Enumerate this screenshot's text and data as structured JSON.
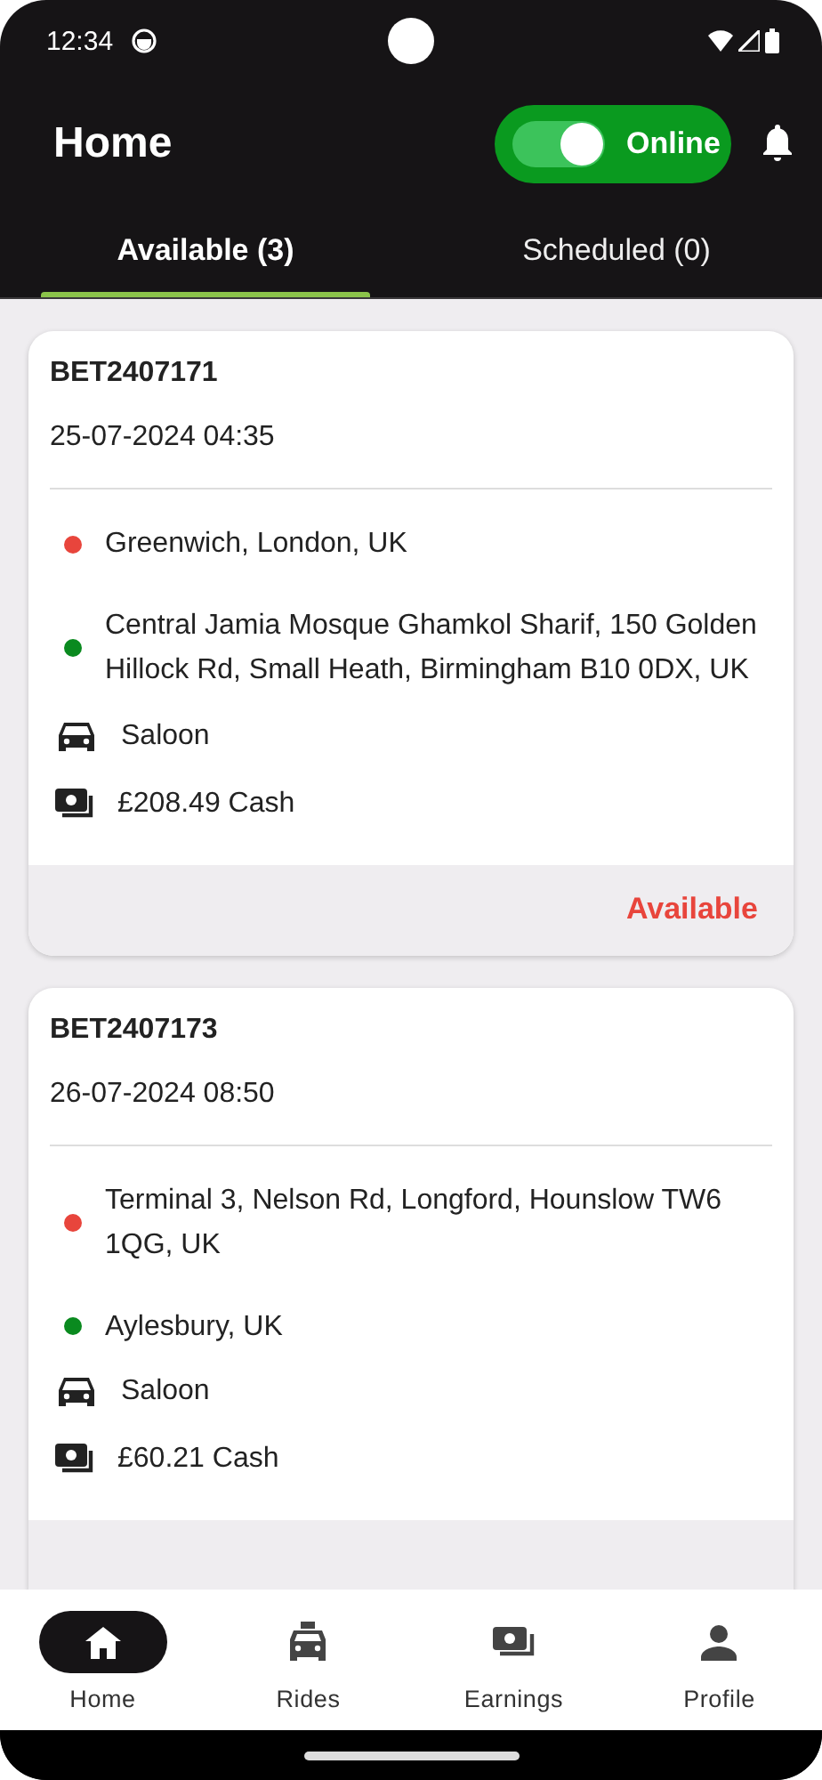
{
  "status_bar": {
    "time": "12:34"
  },
  "header": {
    "title": "Home",
    "online_toggle": {
      "label": "Online",
      "on": true
    }
  },
  "tabs": [
    {
      "label": "Available (3)",
      "selected": true
    },
    {
      "label": "Scheduled (0)",
      "selected": false
    }
  ],
  "rides": [
    {
      "id": "BET2407171",
      "datetime": "25-07-2024 04:35",
      "stops": [
        {
          "address": "Greenwich, London, UK",
          "color": "#e8453c"
        },
        {
          "address": "Central Jamia Mosque Ghamkol Sharif, 150 Golden Hillock Rd, Small Heath, Birmingham B10 0DX, UK",
          "color": "#0a8a1f"
        }
      ],
      "vehicle": "Saloon",
      "fare": "£208.49 Cash",
      "status": "Available"
    },
    {
      "id": "BET2407173",
      "datetime": "26-07-2024 08:50",
      "stops": [
        {
          "address": "Terminal 3, Nelson Rd, Longford, Hounslow TW6 1QG, UK",
          "color": "#e8453c"
        },
        {
          "address": "Aylesbury, UK",
          "color": "#0a8a1f"
        }
      ],
      "vehicle": "Saloon",
      "fare": "£60.21 Cash"
    }
  ],
  "nav": [
    {
      "label": "Home",
      "kind": "home",
      "selected": true
    },
    {
      "label": "Rides",
      "kind": "rides",
      "selected": false
    },
    {
      "label": "Earnings",
      "kind": "earnings",
      "selected": false
    },
    {
      "label": "Profile",
      "kind": "profile",
      "selected": false
    }
  ]
}
